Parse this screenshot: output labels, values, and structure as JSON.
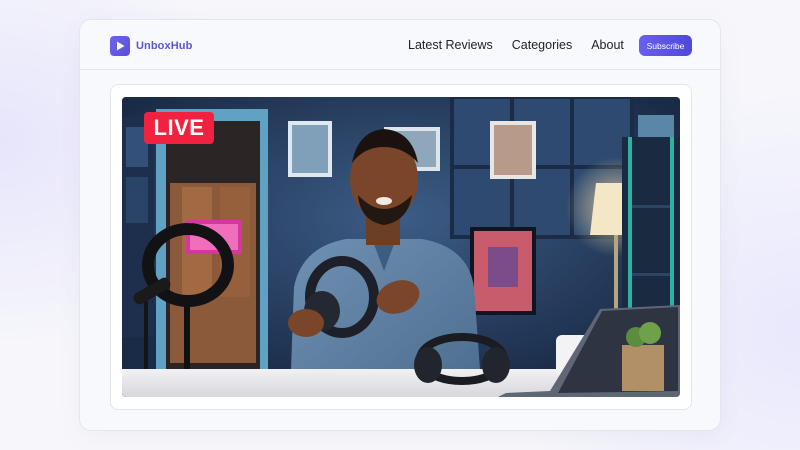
{
  "brand": {
    "name": "UnboxHub",
    "logo_icon": "play-icon",
    "accent": "#5b55cf"
  },
  "nav": {
    "links": [
      "Latest Reviews",
      "Categories",
      "About"
    ],
    "subscribe_label": "Subscribe"
  },
  "video": {
    "badge": "LIVE",
    "badge_color": "#f0223f",
    "scene": "reviewer-holding-headphones"
  }
}
